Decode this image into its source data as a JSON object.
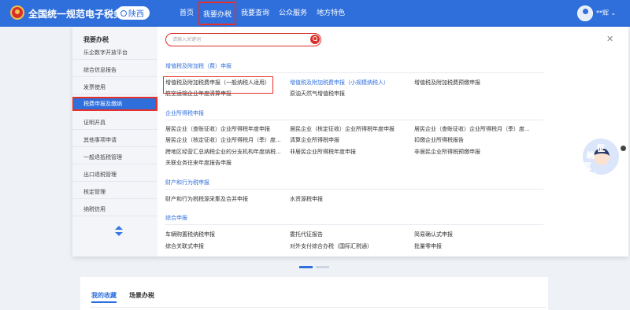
{
  "header": {
    "site_title": "全国统一规范电子税务局",
    "region": "陕西",
    "nav": [
      "首页",
      "我要办税",
      "我要查询",
      "公众服务",
      "地方特色"
    ],
    "active_nav_index": 1,
    "user_name": "**辉"
  },
  "sidebar": {
    "heading": "我要办税",
    "items": [
      "乐企数字开放平台",
      "综合信息报告",
      "发票使用",
      "税费申报及缴纳",
      "证明开具",
      "其他事项申请",
      "一般退抵税管理",
      "出口退税管理",
      "核定管理",
      "纳税信用"
    ],
    "active_index": 3
  },
  "search": {
    "placeholder": "请输入关键词"
  },
  "categories": [
    {
      "title": "增值税及附加税（费）申报",
      "links": [
        [
          "增值税及附加税费申报（一般纳税人适用）",
          "增值税及附加税费申报（小规模纳税人）",
          "增值税及附加税费预缴申报"
        ],
        [
          "航空运输企业年度清算申报",
          "原油天然气增值税申报"
        ]
      ]
    },
    {
      "title": "企业所得税申报",
      "links": [
        [
          "居民企业（查账征收）企业所得税年度申报",
          "居民企业（核定征收）企业所得税年度申报",
          "居民企业（查账征收）企业所得税月（季）度..."
        ],
        [
          "居民企业（核定征收）企业所得税月（季）度...",
          "清算企业所得税申报",
          "扣缴企业所得税报告"
        ],
        [
          "跨地区经营汇总纳税企业的分支机构年度纳税...",
          "非居民企业所得税年度申报",
          "非居民企业所得税预缴申报"
        ],
        [
          "关联业务往来年度报告申报"
        ]
      ]
    },
    {
      "title": "财产和行为税申报",
      "links": [
        [
          "财产和行为税税源采集及合并申报",
          "水资源税申报"
        ]
      ]
    },
    {
      "title": "综合申报",
      "links": [
        [
          "车辆购置税纳税申报",
          "委托代征报告",
          "简易确认式申报"
        ],
        [
          "综合关联式申报",
          "对外支付综合办税（国际汇税通）",
          "批量零申报"
        ]
      ]
    }
  ],
  "assistant": {
    "chars": [
      "征",
      "纳",
      "互",
      "动"
    ]
  },
  "bottom_tabs": [
    "我的收藏",
    "场景办税"
  ],
  "colors": {
    "primary": "#2f6fdc",
    "highlight": "#e8302a"
  }
}
